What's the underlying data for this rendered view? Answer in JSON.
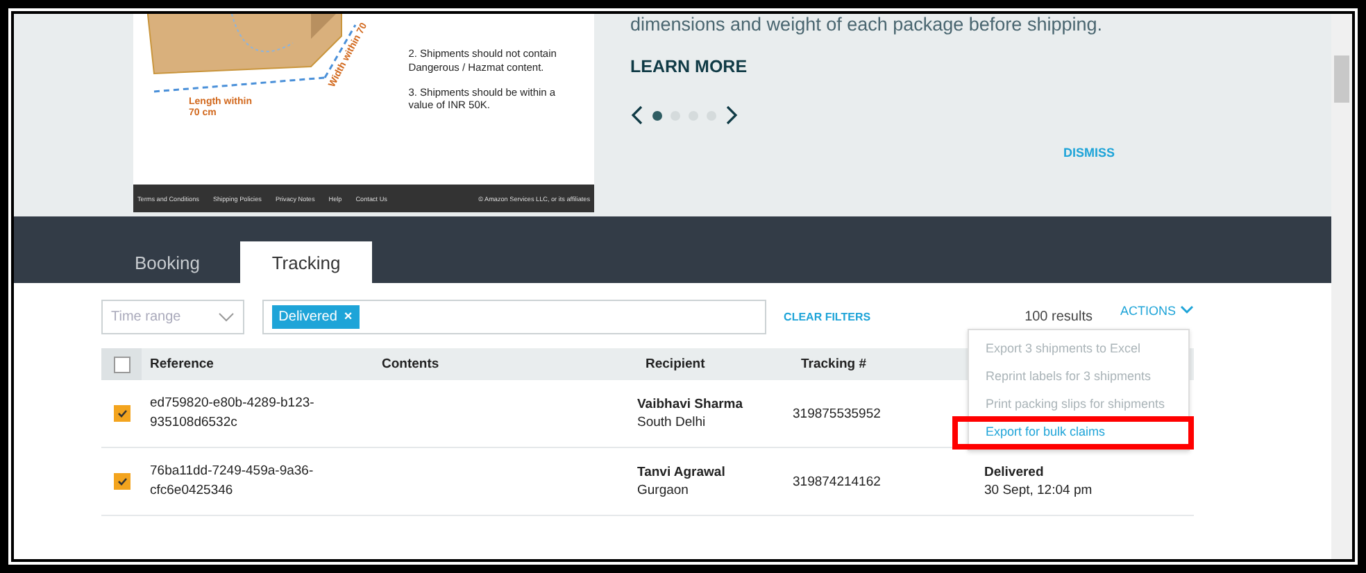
{
  "promo": {
    "diagram_labels": [
      "Length within\n70 cm",
      "Width within 70"
    ],
    "rules": [
      "2. Shipments should not contain Dangerous / Hazmat content.",
      "3. Shipments should be within a value of INR 50K."
    ],
    "footer_links": [
      "Terms and Conditions",
      "Shipping Policies",
      "Privacy Notes",
      "Help",
      "Contact Us"
    ],
    "copyright": "© Amazon Services LLC, or its affiliates",
    "description": "dimensions and weight of each package before shipping.",
    "learn_more": "LEARN MORE",
    "carousel_dots": [
      {
        "selected": true
      },
      {
        "selected": false
      },
      {
        "selected": false
      },
      {
        "selected": false
      }
    ],
    "dismiss": "DISMISS"
  },
  "tabs": [
    {
      "label": "Booking",
      "selected": false
    },
    {
      "label": "Tracking",
      "selected": true
    }
  ],
  "filters": {
    "time_range": {
      "placeholder": "Time range"
    },
    "chips": [
      {
        "label": "Delivered",
        "remove": "×"
      }
    ],
    "clear": "CLEAR FILTERS",
    "results": "100 results",
    "actions": "ACTIONS"
  },
  "table": {
    "select_all_checked": false,
    "columns": [
      "Reference",
      "Contents",
      "Recipient",
      "Tracking #"
    ],
    "rows": [
      {
        "checked": true,
        "reference": "ed759820-e80b-4289-b123-935108d6532c",
        "recipient": "Vaibhavi Sharma",
        "city": "South Delhi",
        "tracking": "319875535952"
      },
      {
        "checked": true,
        "reference": "76ba11dd-7249-459a-9a36-cfc6e0425346",
        "recipient": "Tanvi Agrawal",
        "city": "Gurgaon",
        "tracking": "319874214162",
        "status": "Delivered",
        "status_time": "30 Sept, 12:04 pm"
      }
    ]
  },
  "actions_menu": [
    {
      "label": "Export 3 shipments to Excel",
      "disabled": true,
      "highlighted": false
    },
    {
      "label": "Reprint labels for 3 shipments",
      "disabled": true,
      "highlighted": false
    },
    {
      "label": "Print packing slips for shipments",
      "disabled": true,
      "highlighted": false
    },
    {
      "label": "Export for bulk claims",
      "disabled": false,
      "highlighted": true
    }
  ]
}
